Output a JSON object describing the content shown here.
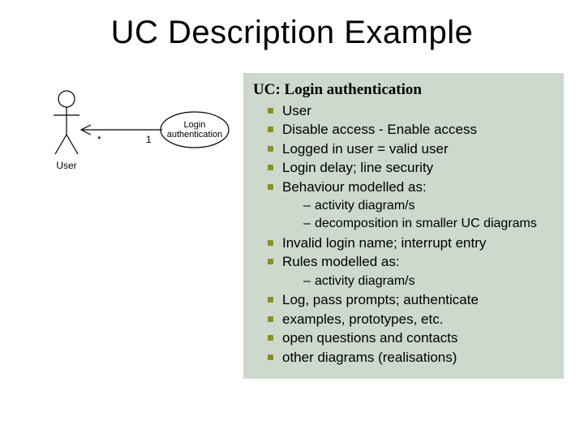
{
  "title": "UC Description Example",
  "diagram": {
    "actor_label": "User",
    "usecase_label_line1": "Login",
    "usecase_label_line2": "authentication",
    "mult_left": "*",
    "mult_right": "1"
  },
  "panel": {
    "header": "UC: Login authentication",
    "items": [
      {
        "text": "User"
      },
      {
        "text": "Disable access - Enable access"
      },
      {
        "text": "Logged in user = valid user"
      },
      {
        "text": "Login delay; line security"
      },
      {
        "text": "Behaviour modelled as:",
        "sub": [
          "activity diagram/s",
          "decomposition in smaller UC diagrams"
        ]
      },
      {
        "text": "Invalid login name; interrupt entry"
      },
      {
        "text": "Rules modelled as:",
        "sub": [
          "activity diagram/s"
        ]
      },
      {
        "text": "Log, pass prompts; authenticate"
      },
      {
        "text": "examples, prototypes, etc."
      },
      {
        "text": "open questions and contacts"
      },
      {
        "text": "other diagrams (realisations)"
      }
    ]
  }
}
